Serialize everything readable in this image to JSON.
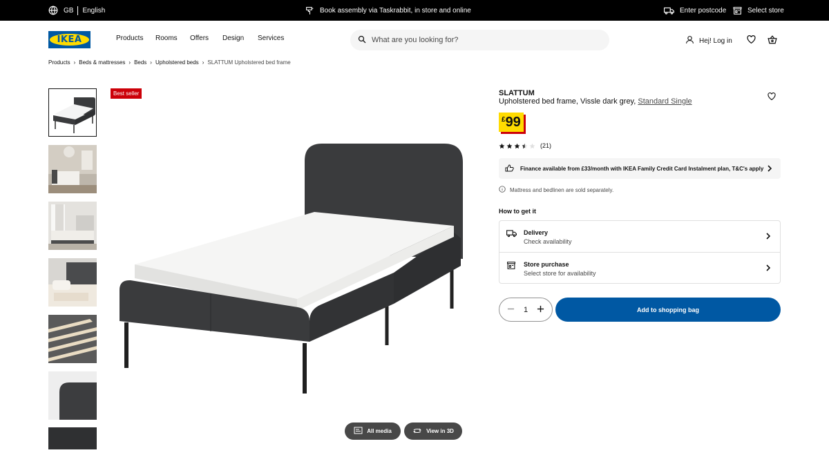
{
  "topbar": {
    "country": "GB",
    "language": "English",
    "promo": "Book assembly via Taskrabbit, in store and online",
    "postcode": "Enter postcode",
    "store": "Select store"
  },
  "header": {
    "logo": "IKEA",
    "nav": [
      "Products",
      "Rooms",
      "Offers",
      "Design",
      "Services"
    ],
    "search_placeholder": "What are you looking for?",
    "login": "Hej! Log in"
  },
  "breadcrumb": [
    "Products",
    "Beds & mattresses",
    "Beds",
    "Upholstered beds",
    "SLATTUM Upholstered bed frame"
  ],
  "gallery": {
    "badge": "Best seller",
    "all_media": "All media",
    "view_3d": "View in 3D",
    "thumbnail_count": 7,
    "active_index": 0
  },
  "product": {
    "name": "SLATTUM",
    "description": "Upholstered bed frame, Vissle dark grey,",
    "size_link": "Standard Single",
    "currency": "£",
    "price": "99",
    "rating": 3.5,
    "review_count": "(21)",
    "finance": "Finance available from £33/month with IKEA Family Credit Card Instalment plan, T&C's apply",
    "note": "Mattress and bedlinen are sold separately."
  },
  "fulfilment": {
    "heading": "How to get it",
    "delivery_title": "Delivery",
    "delivery_sub": "Check availability",
    "store_title": "Store purchase",
    "store_sub": "Select store for availability"
  },
  "purchase": {
    "quantity": "1",
    "add_label": "Add to shopping bag"
  },
  "colors": {
    "brand_blue": "#0058a3",
    "brand_yellow": "#ffdb00",
    "badge_red": "#cc0008",
    "upholstery": "#3a3b3d"
  }
}
